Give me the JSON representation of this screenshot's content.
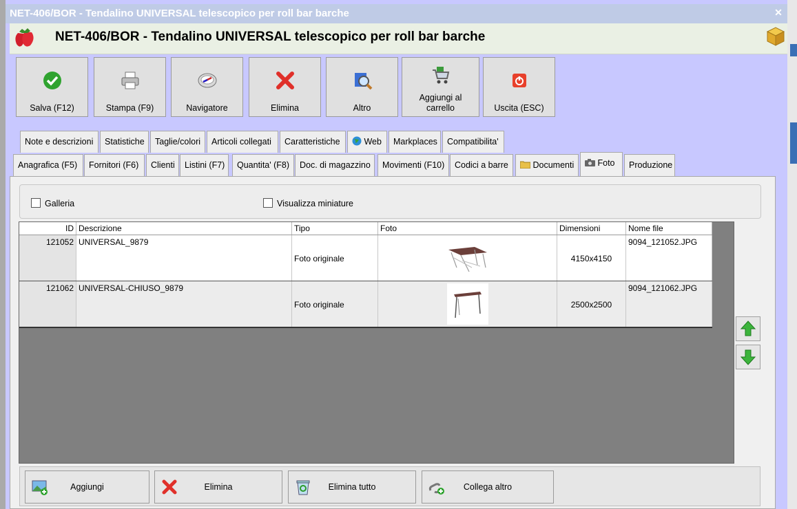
{
  "window": {
    "title": "NET-406/BOR - Tendalino UNIVERSAL telescopico per roll bar barche",
    "header_title": "NET-406/BOR - Tendalino UNIVERSAL telescopico per roll bar barche"
  },
  "toolbar": {
    "save": "Salva (F12)",
    "print": "Stampa (F9)",
    "navigator": "Navigatore",
    "delete": "Elimina",
    "other": "Altro",
    "cart_line1": "Aggiungi al",
    "cart_line2": "carrello",
    "exit": "Uscita (ESC)"
  },
  "tabs_row1": [
    "Note e descrizioni",
    "Statistiche",
    "Taglie/colori",
    "Articoli collegati",
    "Caratteristiche",
    "Web",
    "Markplaces",
    "Compatibilita'"
  ],
  "tabs_row2": [
    "Anagrafica (F5)",
    "Fornitori (F6)",
    "Clienti",
    "Listini (F7)",
    "Quantita' (F8)",
    "Doc. di magazzino",
    "Movimenti (F10)",
    "Codici a barre",
    "Documenti",
    "Foto",
    "Produzione"
  ],
  "options": {
    "gallery": "Galleria",
    "thumbnails": "Visualizza miniature"
  },
  "grid": {
    "columns": [
      "ID",
      "Descrizione",
      "Tipo",
      "Foto",
      "Dimensioni",
      "Nome file"
    ],
    "rows": [
      {
        "id": "121052",
        "descrizione": "UNIVERSAL_9879",
        "tipo": "Foto originale",
        "dimensioni": "4150x4150",
        "nome_file": "9094_121052.JPG"
      },
      {
        "id": "121062",
        "descrizione": "UNIVERSAL-CHIUSO_9879",
        "tipo": "Foto originale",
        "dimensioni": "2500x2500",
        "nome_file": "9094_121062.JPG"
      }
    ]
  },
  "bottom": {
    "add": "Aggiungi",
    "delete": "Elimina",
    "delete_all": "Elimina tutto",
    "link_other": "Collega altro"
  },
  "colors": {
    "window_bg": "#c8c8ff",
    "header_bg": "#eaf0e4",
    "grid_bg": "#808080"
  }
}
